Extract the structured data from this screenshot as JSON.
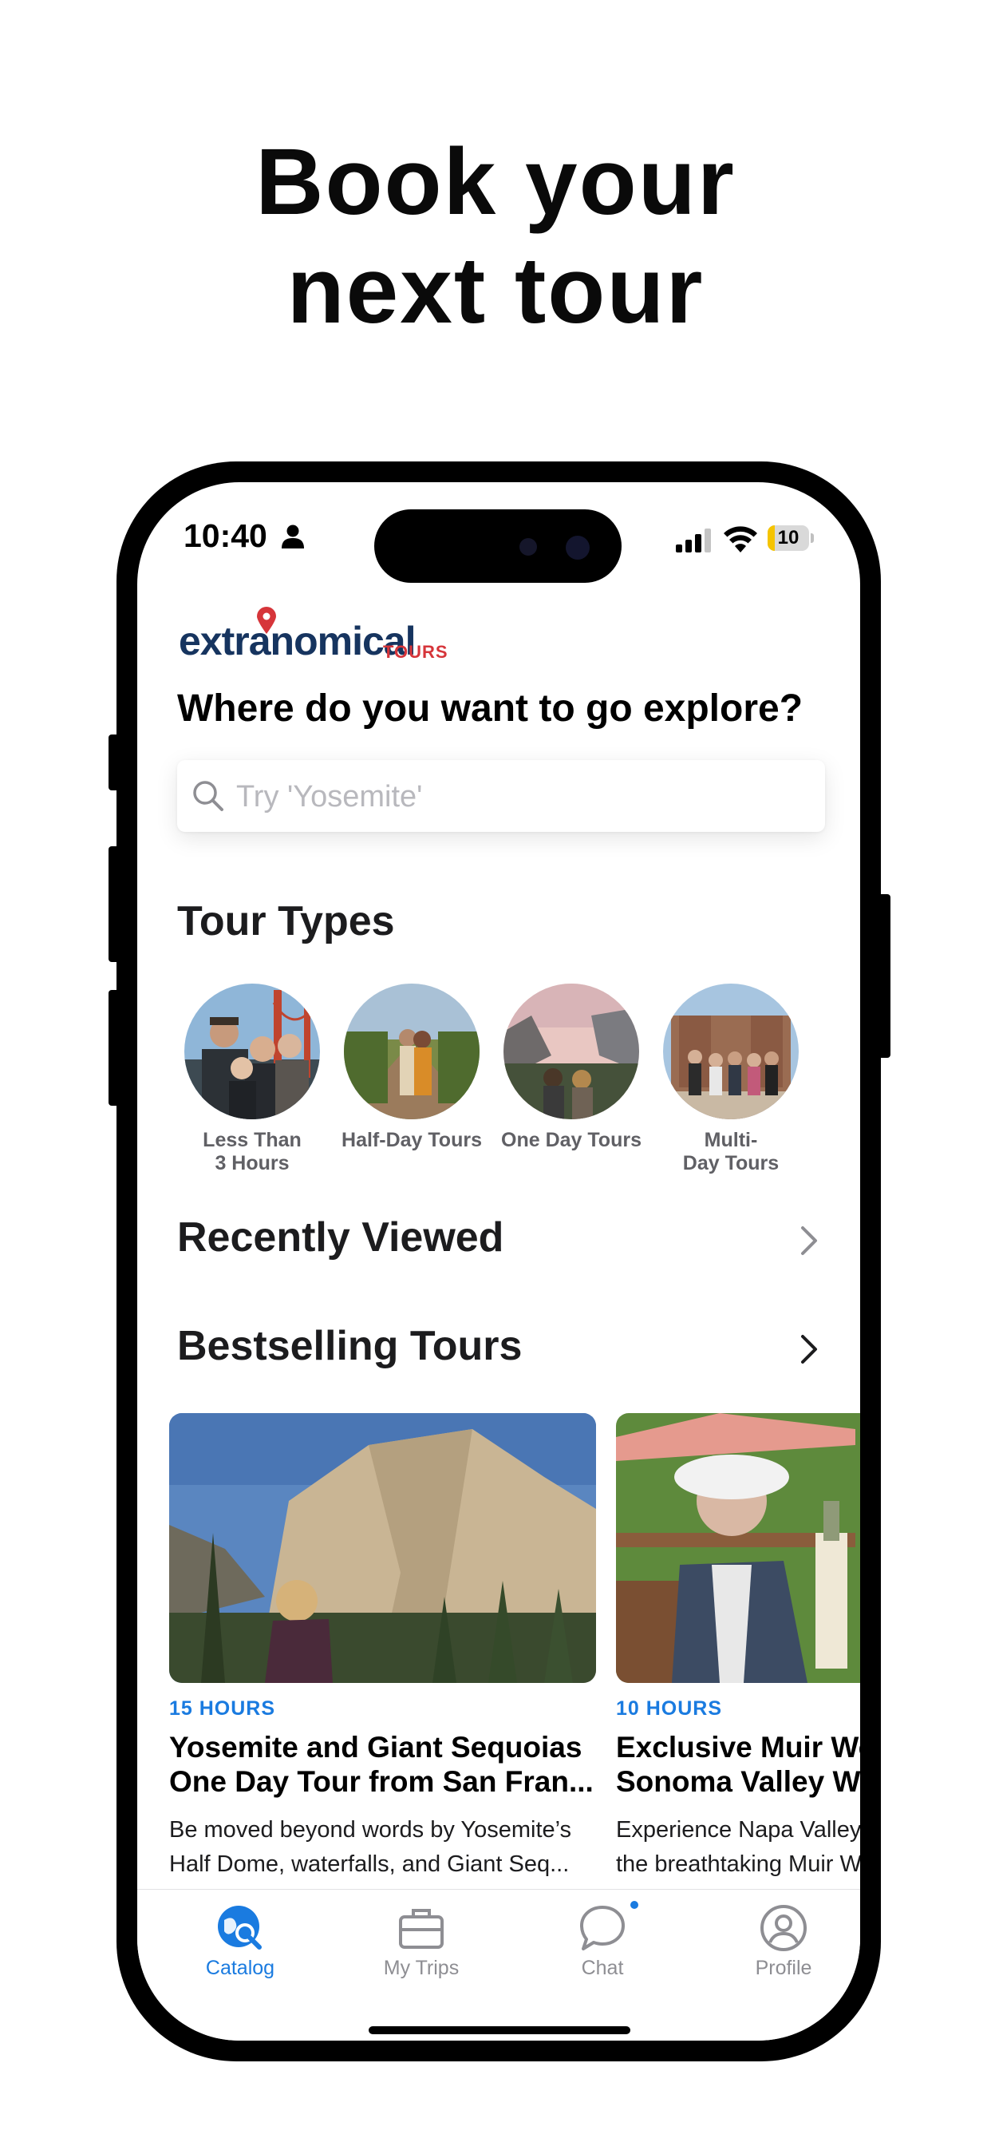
{
  "marketing": {
    "headline_line1": "Book your",
    "headline_line2": "next tour"
  },
  "status_bar": {
    "time": "10:40",
    "battery_level": "10",
    "battery_fraction": 0.1
  },
  "logo": {
    "main": "extranomical",
    "sub": "TOURS"
  },
  "search": {
    "question": "Where do you want to go explore?",
    "placeholder": "Try 'Yosemite'"
  },
  "tour_types": {
    "title": "Tour Types",
    "items": [
      {
        "label": "Less Than\n3 Hours"
      },
      {
        "label": "Half-Day Tours"
      },
      {
        "label": "One Day Tours"
      },
      {
        "label": "Multi-\nDay Tours"
      }
    ]
  },
  "recently_viewed": {
    "title": "Recently Viewed"
  },
  "bestselling": {
    "title": "Bestselling Tours",
    "cards": [
      {
        "duration": "15 HOURS",
        "title_line1": "Yosemite and Giant Sequoias",
        "title_line2": "One Day Tour from San Fran...",
        "desc_line1": "Be moved beyond words by Yosemite’s",
        "desc_line2": "Half Dome, waterfalls, and Giant Seq..."
      },
      {
        "duration": "10 HOURS",
        "title_line1": "Exclusive Muir Wo",
        "title_line2": "Sonoma Valley Wi",
        "desc_line1": "Experience Napa Valley",
        "desc_line2": "the breathtaking Muir W"
      }
    ]
  },
  "tab_bar": {
    "items": [
      {
        "label": "Catalog",
        "icon": "catalog-icon",
        "active": true
      },
      {
        "label": "My Trips",
        "icon": "briefcase-icon",
        "active": false
      },
      {
        "label": "Chat",
        "icon": "chat-bubble-icon",
        "active": false
      },
      {
        "label": "Profile",
        "icon": "profile-icon",
        "active": false
      }
    ]
  },
  "colors": {
    "accent": "#1a7be0",
    "logo_navy": "#16345f",
    "logo_red": "#d6353a"
  }
}
